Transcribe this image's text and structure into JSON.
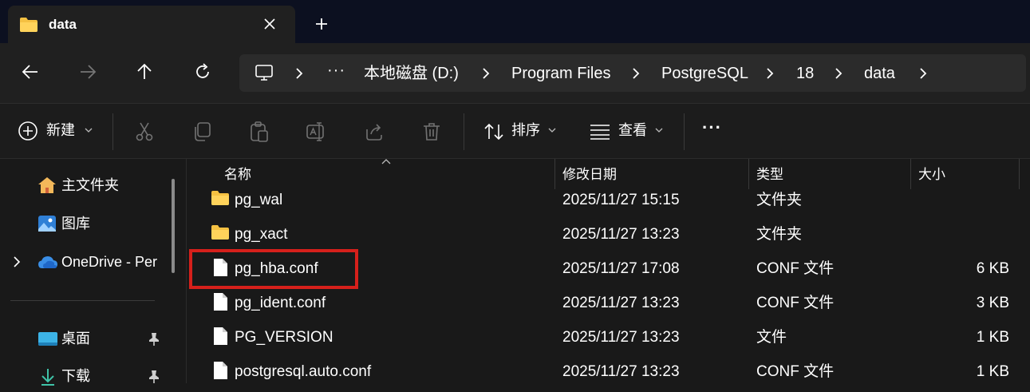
{
  "tab": {
    "title": "data",
    "icon": "folder-icon",
    "close_icon": "close-icon",
    "new_tab_icon": "plus-icon"
  },
  "nav": {
    "back_icon": "back-arrow-icon",
    "forward_icon": "forward-arrow-icon",
    "up_icon": "up-arrow-icon",
    "refresh_icon": "refresh-icon"
  },
  "address": {
    "root_icon": "computer-icon",
    "overflow": "···",
    "segments": [
      "本地磁盘 (D:)",
      "Program Files",
      "PostgreSQL",
      "18",
      "data"
    ]
  },
  "commands": {
    "new_label": "新建",
    "sort_label": "排序",
    "view_label": "查看",
    "more_label": "···",
    "icons": [
      "cut-icon",
      "copy-icon",
      "paste-icon",
      "rename-icon",
      "share-icon",
      "delete-icon"
    ]
  },
  "sidebar": {
    "items": [
      {
        "label": "主文件夹",
        "icon": "home-icon"
      },
      {
        "label": "图库",
        "icon": "gallery-icon"
      },
      {
        "label": "OneDrive - Per",
        "icon": "onedrive-cloud-icon"
      },
      {
        "label": "桌面",
        "icon": "desktop-icon",
        "pinned": true
      },
      {
        "label": "下载",
        "icon": "download-icon",
        "pinned": true
      }
    ]
  },
  "columns": {
    "name": "名称",
    "date": "修改日期",
    "type": "类型",
    "size": "大小"
  },
  "files": [
    {
      "name": "pg_wal",
      "date": "2025/11/27 15:15",
      "type": "文件夹",
      "size": "",
      "kind": "folder"
    },
    {
      "name": "pg_xact",
      "date": "2025/11/27 13:23",
      "type": "文件夹",
      "size": "",
      "kind": "folder"
    },
    {
      "name": "pg_hba.conf",
      "date": "2025/11/27 17:08",
      "type": "CONF 文件",
      "size": "6 KB",
      "kind": "file",
      "highlighted": true
    },
    {
      "name": "pg_ident.conf",
      "date": "2025/11/27 13:23",
      "type": "CONF 文件",
      "size": "3 KB",
      "kind": "file"
    },
    {
      "name": "PG_VERSION",
      "date": "2025/11/27 13:23",
      "type": "文件",
      "size": "1 KB",
      "kind": "file"
    },
    {
      "name": "postgresql.auto.conf",
      "date": "2025/11/27 13:23",
      "type": "CONF 文件",
      "size": "1 KB",
      "kind": "file"
    }
  ],
  "colors": {
    "background": "#191919",
    "tabstrip": "#0c1020",
    "folder_yellow": "#f5c142",
    "highlight_red": "#d6201b",
    "onedrive_blue": "#3a8ee6"
  }
}
